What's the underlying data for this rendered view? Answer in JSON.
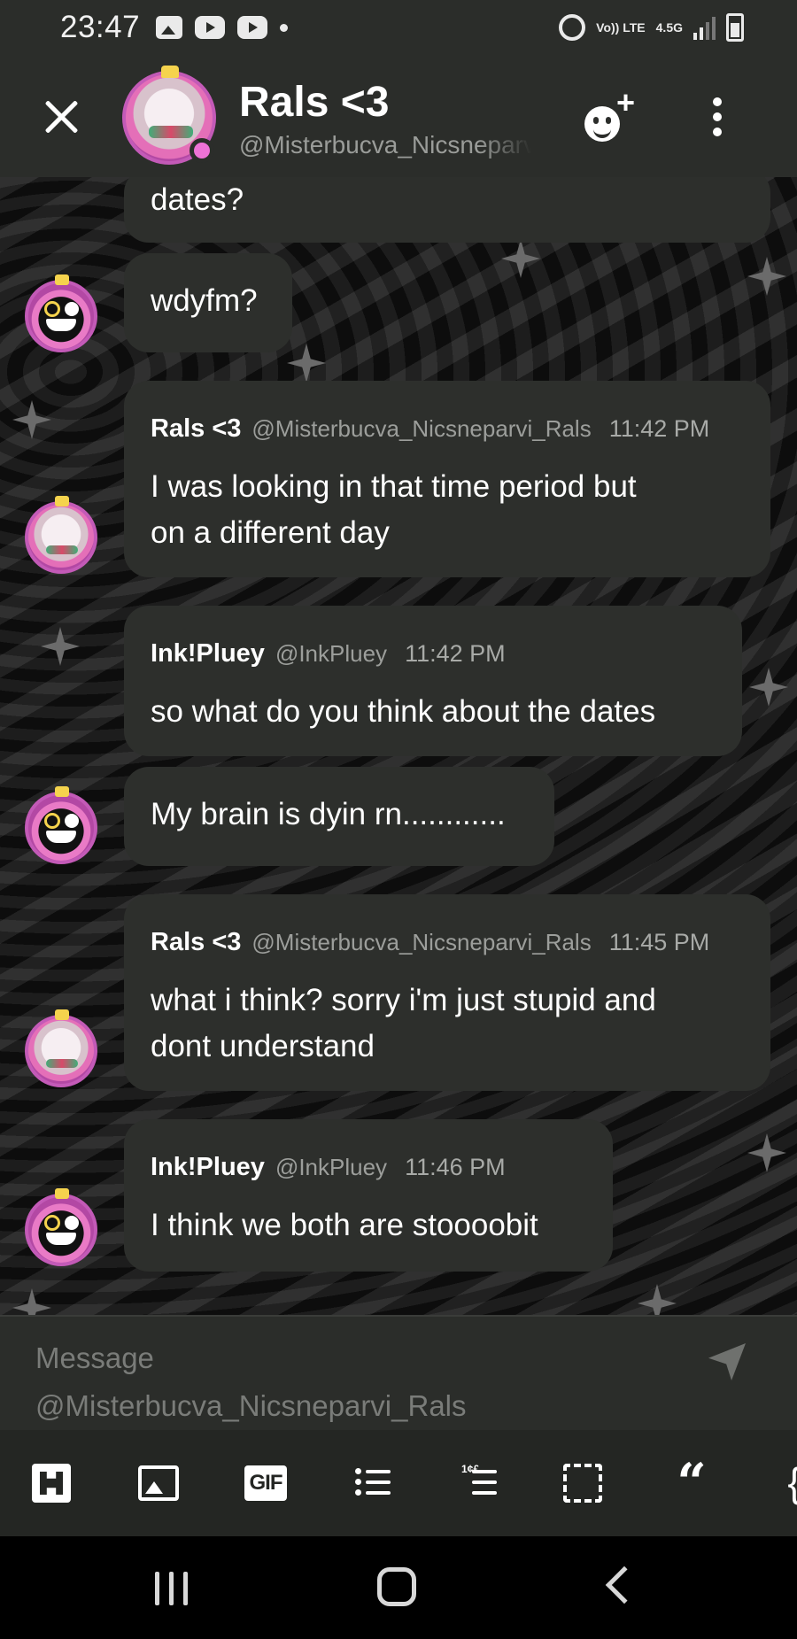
{
  "status_bar": {
    "time": "23:47",
    "network_top": "Vo)) LTE",
    "network_speed": "4.5G",
    "icons": [
      "gallery-icon",
      "youtube-icon",
      "youtube-icon",
      "dot-icon",
      "alarm-icon",
      "signal-icon",
      "battery-icon"
    ]
  },
  "header": {
    "title": "Rals <3",
    "handle": "@Misterbucva_Nicsneparvi_Rals",
    "online_color": "#ee72d6"
  },
  "messages": [
    {
      "type": "continuation",
      "text": "dates?"
    },
    {
      "type": "single",
      "avatar": "ink",
      "text": "wdyfm?"
    },
    {
      "type": "full",
      "avatar": "rals",
      "author": "Rals <3",
      "handle": "@Misterbucva_Nicsneparvi_Rals",
      "time": "11:42 PM",
      "text_lines": [
        "I was looking in that time period but",
        "on a different day"
      ]
    },
    {
      "type": "full",
      "avatar": "ink",
      "author": "Ink!Pluey",
      "handle": "@InkPluey",
      "time": "11:42 PM",
      "text_lines": [
        "so what do you think about the dates"
      ]
    },
    {
      "type": "single",
      "avatar": "ink",
      "text": "My brain is dyin rn............"
    },
    {
      "type": "full",
      "avatar": "rals",
      "author": "Rals <3",
      "handle": "@Misterbucva_Nicsneparvi_Rals",
      "time": "11:45 PM",
      "text_lines": [
        "what i think? sorry i'm just stupid and",
        "dont understand"
      ]
    },
    {
      "type": "full",
      "avatar": "ink",
      "author": "Ink!Pluey",
      "handle": "@InkPluey",
      "time": "11:46 PM",
      "text_lines": [
        "I think we both are stoooobit"
      ]
    }
  ],
  "composer": {
    "placeholder_line1": "Message",
    "placeholder_line2": "@Misterbucva_Nicsneparvi_Rals"
  },
  "toolbar": {
    "gif_label": "GIF",
    "quote_label": "“",
    "code_label": "{"
  },
  "colors": {
    "bubble": "#2d2f2c",
    "header": "#2b2d2a",
    "avatar_ring": "#c35ab7"
  }
}
